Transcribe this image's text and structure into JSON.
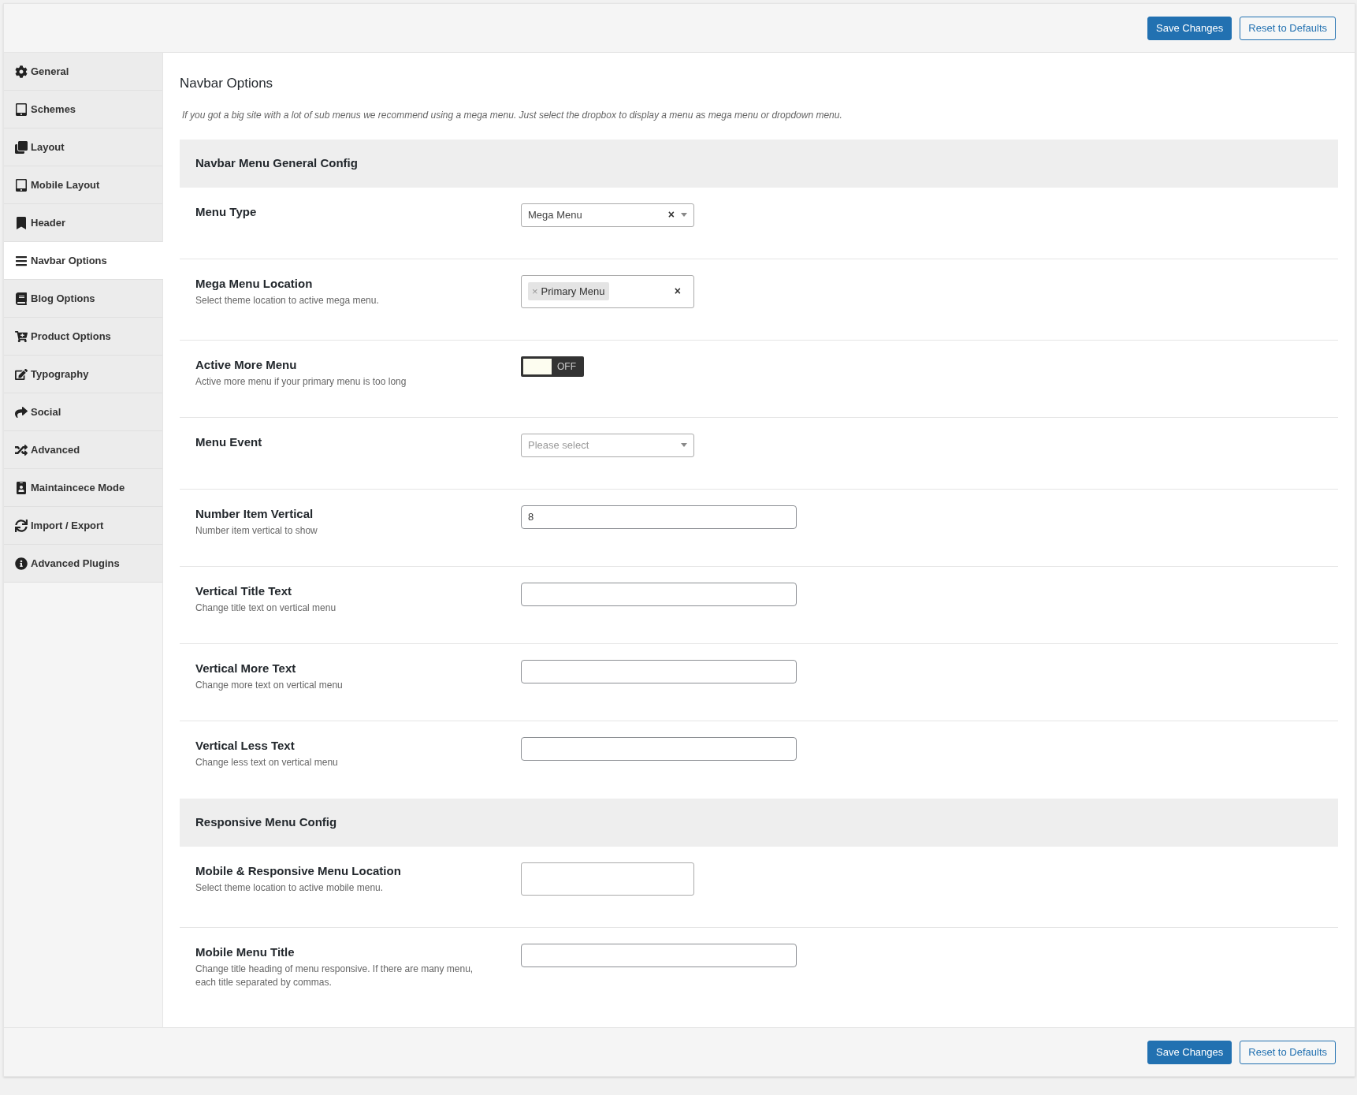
{
  "top_bar": {
    "buttons": [
      {
        "label": "Save Changes",
        "kind": "primary"
      },
      {
        "label": "Reset to Defaults",
        "kind": "secondary"
      }
    ]
  },
  "sidebar": {
    "items": [
      {
        "label": "General",
        "selected": false
      },
      {
        "label": "Schemes",
        "selected": false
      },
      {
        "label": "Layout",
        "selected": false
      },
      {
        "label": "Mobile Layout",
        "selected": false
      },
      {
        "label": "Header",
        "selected": false
      },
      {
        "label": "Navbar Options",
        "selected": true
      },
      {
        "label": "Blog Options",
        "selected": false
      },
      {
        "label": "Product Options",
        "selected": false
      },
      {
        "label": "Typography",
        "selected": false
      },
      {
        "label": "Social",
        "selected": false
      },
      {
        "label": "Advanced",
        "selected": false
      },
      {
        "label": "Maintaincece Mode",
        "selected": false
      },
      {
        "label": "Import / Export",
        "selected": false
      },
      {
        "label": "Advanced Plugins",
        "selected": false
      }
    ]
  },
  "page": {
    "title": "Navbar Options",
    "description": "If you got a big site with a lot of sub menus we recommend using a mega menu. Just select the dropbox to display a menu as mega menu or dropdown menu.",
    "sections": [
      {
        "title": "Navbar Menu General Config",
        "fields": [
          {
            "kind": "select",
            "label": "Menu Type",
            "value": "Mega Menu",
            "clear": "×"
          },
          {
            "kind": "multiselect",
            "label": "Mega Menu Location",
            "help": "Select theme location to active mega menu.",
            "tags": [
              {
                "remove": "×",
                "label": "Primary Menu"
              }
            ],
            "clear": "×"
          },
          {
            "kind": "toggle",
            "label": "Active More Menu",
            "help": "Active more menu if your primary menu is too long",
            "on": false,
            "state_label": "OFF"
          },
          {
            "kind": "select",
            "label": "Menu Event",
            "placeholder": "Please select"
          },
          {
            "kind": "text",
            "label": "Number Item Vertical",
            "help": "Number item vertical to show",
            "value": "8"
          },
          {
            "kind": "text",
            "label": "Vertical Title Text",
            "help": "Change title text on vertical menu"
          },
          {
            "kind": "text",
            "label": "Vertical More Text",
            "help": "Change more text on vertical menu"
          },
          {
            "kind": "text",
            "label": "Vertical Less Text",
            "help": "Change less text on vertical menu"
          }
        ]
      },
      {
        "title": "Responsive Menu Config",
        "fields": [
          {
            "kind": "multiselect",
            "label": "Mobile & Responsive Menu Location",
            "help": "Select theme location to active mobile menu."
          },
          {
            "kind": "text",
            "label": "Mobile Menu Title",
            "help": "Change title heading of menu responsive. If there are many menu, each title separated by commas."
          }
        ]
      }
    ]
  },
  "footer": {
    "buttons": [
      {
        "label": "Save Changes",
        "kind": "primary"
      },
      {
        "label": "Reset to Defaults",
        "kind": "secondary"
      }
    ]
  }
}
